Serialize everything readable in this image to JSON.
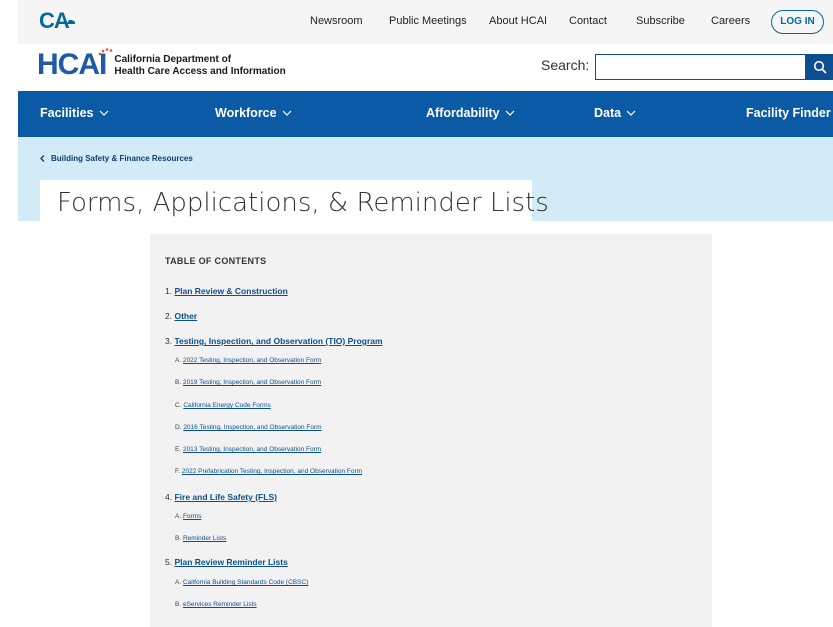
{
  "utility": {
    "logo_text": "CA",
    "links": [
      "Newsroom",
      "Public Meetings",
      "About HCAI",
      "Contact",
      "Subscribe",
      "Careers"
    ],
    "login_label": "LOG IN"
  },
  "brand": {
    "logo_text": "HCAI",
    "org_line1": "California Department of",
    "org_line2": "Health Care Access and Information",
    "search_label": "Search:",
    "search_value": ""
  },
  "nav": {
    "items": [
      "Facilities",
      "Workforce",
      "Affordability",
      "Data",
      "Facility Finder"
    ]
  },
  "breadcrumb": {
    "label": "Building Safety & Finance Resources"
  },
  "page_title": "Forms, Applications, & Reminder Lists",
  "toc": {
    "heading": "TABLE OF CONTENTS",
    "items": [
      {
        "num": "1.",
        "label": "Plan Review & Construction"
      },
      {
        "num": "2.",
        "label": "Other"
      },
      {
        "num": "3.",
        "label": "Testing, Inspection, and Observation (TIO) Program"
      },
      {
        "num": "4.",
        "label": "Fire and Life Safety (FLS)"
      },
      {
        "num": "5.",
        "label": "Plan Review Reminder Lists"
      }
    ],
    "tio_subitems": [
      {
        "letter": "A.",
        "label": "2022 Testing, Inspection, and Observation Form"
      },
      {
        "letter": "B.",
        "label": "2019 Testing, Inspection, and Observation Form"
      },
      {
        "letter": "C.",
        "label": "California Energy Code Forms"
      },
      {
        "letter": "D.",
        "label": "2016 Testing, Inspection, and Observation Form"
      },
      {
        "letter": "E.",
        "label": "2013 Testing, Inspection, and Observation Form"
      },
      {
        "letter": "F.",
        "label": "2022 Prefabrication Testing, Inspection, and Observation Form"
      }
    ],
    "fls_subitems": [
      {
        "letter": "A.",
        "label": "Forms"
      },
      {
        "letter": "B.",
        "label": "Reminder Lists"
      }
    ],
    "plan_subitems": [
      {
        "letter": "A.",
        "label": "California Building Standards Code (CBSC)"
      },
      {
        "letter": "B.",
        "label": "eServices Reminder Lists"
      }
    ]
  },
  "colors": {
    "nav_bg": "#0b5aa6",
    "hero_bg": "#d3ebf7",
    "link": "#0b4f91",
    "toc_bg": "#f2f2f2"
  }
}
